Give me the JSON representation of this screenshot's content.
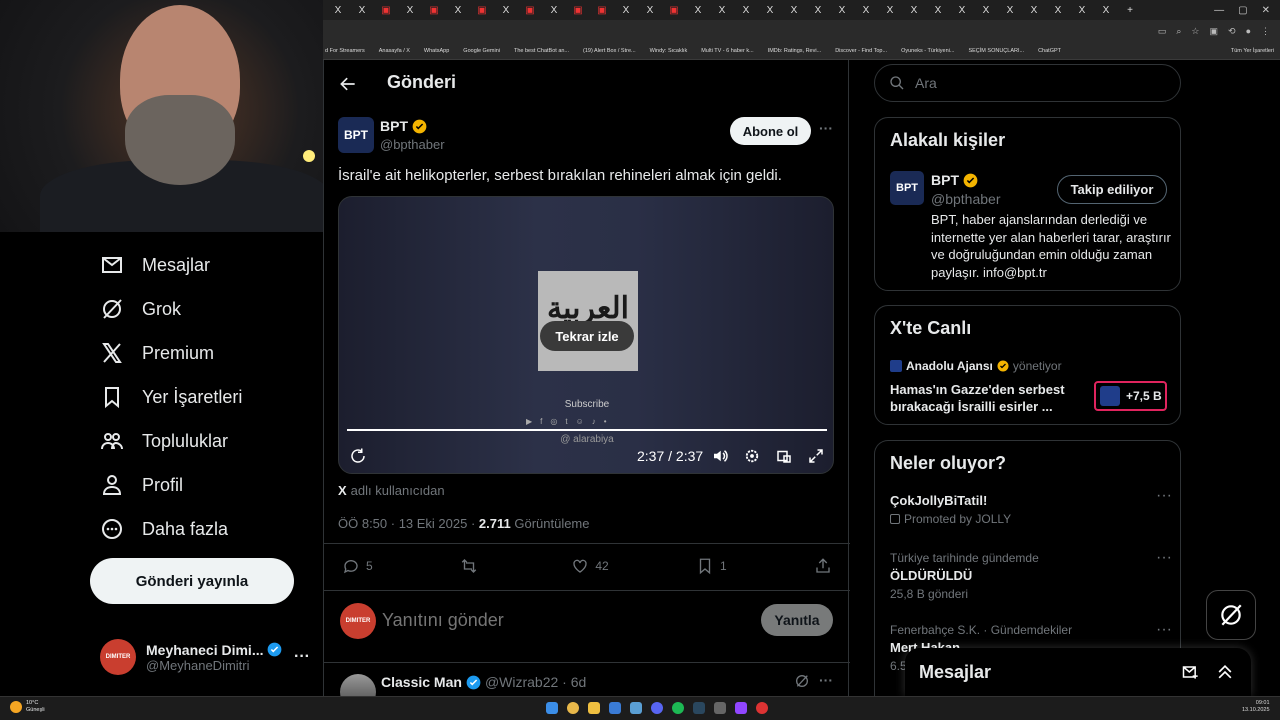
{
  "browser": {
    "tabs": [
      "X",
      "X",
      "▣",
      "X",
      "▣",
      "X",
      "▣",
      "X",
      "▣",
      "X",
      "▣",
      "▣",
      "X",
      "X",
      "▣",
      "X",
      "X",
      "X",
      "X",
      "X",
      "X",
      "X",
      "X",
      "X",
      "X",
      "X",
      "X",
      "X",
      "X",
      "X",
      "X",
      "X",
      "X"
    ],
    "tab_new": "+",
    "bookmarks": [
      "d For Streamers",
      "Anasayfa / X",
      "WhatsApp",
      "Google Gemini",
      "The best ChatBot an...",
      "(19) Alert Box / Stre...",
      "Windy: Sıcaklık",
      "Multi TV - 6 haber k...",
      "IMDb: Ratings, Revi...",
      "Discover - Find Top...",
      "Oyuneks - Türkiyeni...",
      "SEÇİM SONUÇLARI...",
      "ChatGPT"
    ],
    "all_bookmarks": "Tüm Yer İşaretleri"
  },
  "nav": {
    "items": [
      {
        "label": "Mesajlar",
        "icon": "mail-icon"
      },
      {
        "label": "Grok",
        "icon": "grok-icon"
      },
      {
        "label": "Premium",
        "icon": "x-logo-icon"
      },
      {
        "label": "Yer İşaretleri",
        "icon": "bookmark-icon"
      },
      {
        "label": "Topluluklar",
        "icon": "communities-icon"
      },
      {
        "label": "Profil",
        "icon": "person-icon"
      },
      {
        "label": "Daha fazla",
        "icon": "more-circle-icon"
      }
    ],
    "post_button": "Gönderi yayınla",
    "profile": {
      "name": "Meyhaneci Dimi...",
      "handle": "@MeyhaneDimitri",
      "more": "···",
      "avatar_text": "DIMITER"
    }
  },
  "header": {
    "title": "Gönderi"
  },
  "post": {
    "author_name": "BPT",
    "author_handle": "@bpthaber",
    "avatar_text": "BPT",
    "follow_label": "Abone ol",
    "more": "···",
    "text": "İsrail'e ait helikopterler, serbest bırakılan rehineleri almak için geldi.",
    "video": {
      "logo_text": "العربية",
      "replay_label": "Tekrar izle",
      "subscribe": "Subscribe",
      "channel_handle": "@ alarabiya",
      "time": "2:37 / 2:37",
      "progress": 1.0
    },
    "source_label": "adlı kullanıcıdan",
    "source_x": "X",
    "timestamp": "ÖÖ 8:50 · 13 Eki 2025 · ",
    "views_count": "2.711",
    "views_label": " Görüntüleme",
    "actions": {
      "replies": "5",
      "retweets": "",
      "likes": "42",
      "bookmarks": "1"
    }
  },
  "reply_box": {
    "placeholder": "Yanıtını gönder",
    "button": "Yanıtla",
    "avatar_text": "DIMITER"
  },
  "next_reply": {
    "name": "Classic Man",
    "handle": "@Wizrab22 · 6d",
    "more": "···"
  },
  "right": {
    "search_placeholder": "Ara",
    "related": {
      "title": "Alakalı kişiler",
      "name": "BPT",
      "handle": "@bpthaber",
      "following_label": "Takip ediliyor",
      "bio": "BPT, haber ajanslarından derlediği ve internette yer alan haberleri tarar, araştırır ve doğruluğundan emin olduğu zaman paylaşır. info@bpt.tr"
    },
    "live": {
      "title": "X'te Canlı",
      "host": "Anadolu Ajansı",
      "host_role": "yönetiyor",
      "headline": "Hamas'ın Gazze'den serbest bırakacağı İsrailli esirler ...",
      "listeners": "+7,5 B"
    },
    "trends": {
      "title": "Neler oluyor?",
      "items": [
        {
          "context": "",
          "name": "ÇokJollyBiTatil!",
          "meta": "Promoted by JOLLY"
        },
        {
          "context": "Türkiye tarihinde gündemde",
          "name": "ÖLDÜRÜLDÜ",
          "meta": "25,8 B gönderi"
        },
        {
          "context": "Fenerbahçe S.K. · Gündemdekiler",
          "name": "Mert Hakan",
          "meta": "6.5"
        }
      ]
    },
    "messages_drawer": "Mesajlar"
  },
  "taskbar": {
    "weather_temp": "10°C",
    "weather_label": "Güneşli",
    "time": "09:01",
    "date": "13.10.2025"
  },
  "colors": {
    "verified": "#f4b400",
    "verified_blue": "#1d9bf0",
    "live_border": "#e0245e",
    "avatar_red": "#c93e2f"
  }
}
